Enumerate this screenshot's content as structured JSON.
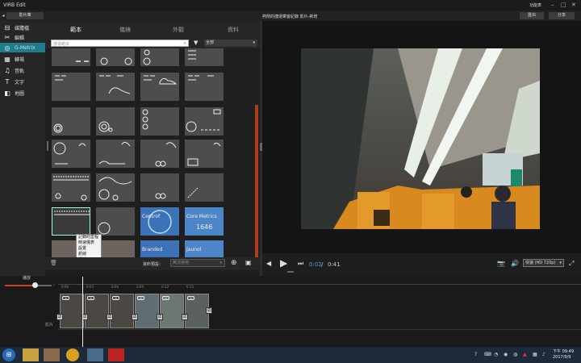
{
  "window": {
    "title": "VIRB Edit",
    "feature_menu": "功能表",
    "min": "–",
    "max": "□",
    "close": "✕"
  },
  "toolbar": {
    "library_label": "影片庫",
    "back_arrow": "◂",
    "project_title": "熱鬧的捷運乘客紀錄 影片-新增",
    "exit_label": "匯出",
    "share_label": "分享"
  },
  "sidebar": {
    "items": [
      {
        "icon": "film-icon",
        "glyph": "⊟",
        "label": "媒體檔"
      },
      {
        "icon": "scissors-icon",
        "glyph": "✂",
        "label": "編輯"
      },
      {
        "icon": "gmetrix-icon",
        "glyph": "◎",
        "label": "G-Metrix"
      },
      {
        "icon": "transition-icon",
        "glyph": "▦",
        "label": "轉場"
      },
      {
        "icon": "music-icon",
        "glyph": "♫",
        "label": "音軌"
      },
      {
        "icon": "text-icon",
        "glyph": "T",
        "label": "文字"
      },
      {
        "icon": "map-icon",
        "glyph": "◧",
        "label": "地圖"
      }
    ]
  },
  "tabs": [
    "範本",
    "儀錶",
    "外觀",
    "資料"
  ],
  "search": {
    "placeholder": "搜尋範本",
    "filter_value": "全部"
  },
  "grid_tiles": [
    {
      "caption": "",
      "number": ""
    },
    {
      "caption": "",
      "number": ""
    },
    {
      "caption": "",
      "number": ""
    },
    {
      "caption": "",
      "number": ""
    },
    {
      "caption": "",
      "number": ""
    },
    {
      "caption": "",
      "number": ""
    },
    {
      "caption": "",
      "number": ""
    },
    {
      "caption": "",
      "number": ""
    },
    {
      "caption": "",
      "number": ""
    },
    {
      "caption": "",
      "number": ""
    },
    {
      "caption": "",
      "number": ""
    },
    {
      "caption": "",
      "number": ""
    },
    {
      "caption": "",
      "number": ""
    },
    {
      "caption": "",
      "number": ""
    },
    {
      "caption": "",
      "number": ""
    },
    {
      "caption": "",
      "number": ""
    },
    {
      "caption": "",
      "number": ""
    },
    {
      "caption": "",
      "number": ""
    },
    {
      "caption": "",
      "number": ""
    },
    {
      "caption": "",
      "number": ""
    },
    {
      "caption": "",
      "number": ""
    },
    {
      "caption": "",
      "number": ""
    },
    {
      "caption": "Centrof",
      "number": ""
    },
    {
      "caption": "Core Metrics",
      "number": "1646"
    },
    {
      "caption": "",
      "number": ""
    },
    {
      "caption": "",
      "number": ""
    },
    {
      "caption": "Branded",
      "number": ""
    },
    {
      "caption": "Jaunol",
      "number": ""
    }
  ],
  "context_menu": [
    "記錄的里程",
    "時速儀表",
    "設置",
    "航線",
    "標誌"
  ],
  "bottom": {
    "preset_label": "資料預設：",
    "preset_placeholder": "無法使用"
  },
  "playback": {
    "current": "0:02",
    "separator": "/",
    "total": "0:41",
    "quality": "快速 (HD 720p)"
  },
  "timeline": {
    "volume_label": "播放",
    "ticks": [
      "0:00",
      "0:03",
      "0:06",
      "0:09",
      "0:12",
      "0:15"
    ],
    "track_label": "影片"
  },
  "taskbar": {
    "time": "下午 09:49",
    "date": "2017/9/9"
  },
  "colors": {
    "accent": "#1e7c8c",
    "highlight": "#d04020",
    "time_blue": "#4aa0d8"
  }
}
